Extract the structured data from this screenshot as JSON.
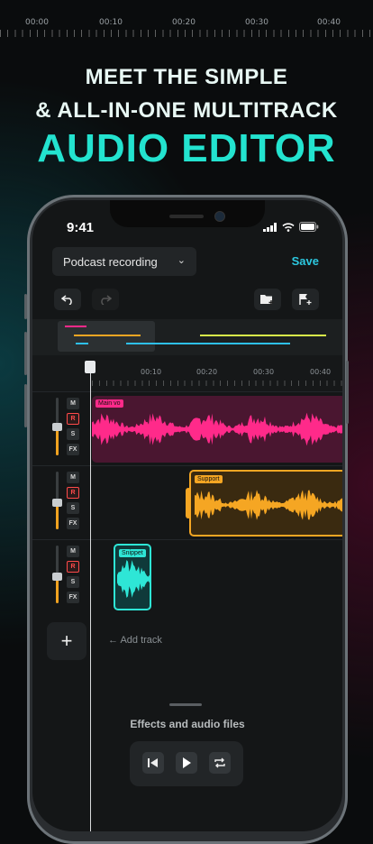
{
  "top_ruler": {
    "labels": [
      "00:00",
      "00:10",
      "00:20",
      "00:30",
      "00:40"
    ]
  },
  "headline": {
    "line1": "MEET THE SIMPLE",
    "line2": "& ALL-IN-ONE MULTITRACK",
    "line3": "AUDIO EDITOR"
  },
  "status_bar": {
    "time": "9:41"
  },
  "editor": {
    "project_name": "Podcast recording",
    "save_label": "Save",
    "timeline_labels": [
      "00:10",
      "00:20",
      "00:30",
      "00:40"
    ],
    "tracks": [
      {
        "controls": [
          "M",
          "R",
          "S",
          "FX"
        ],
        "volume": 0.45,
        "clip_label": "Main vo",
        "clip_color": "#ff2a8a"
      },
      {
        "controls": [
          "M",
          "R",
          "S",
          "FX"
        ],
        "volume": 0.5,
        "clip_label": "Support",
        "clip_color": "#f5a623"
      },
      {
        "controls": [
          "M",
          "R",
          "S",
          "FX"
        ],
        "volume": 0.5,
        "clip_label": "Snippet",
        "clip_color": "#2ee6d6"
      }
    ],
    "add_track_label": "← Add track",
    "bottom_sheet_title": "Effects and audio files"
  },
  "colors": {
    "accent_cyan": "#23e3cf",
    "save_blue": "#2cc8e0",
    "pink": "#ff2a8a",
    "orange": "#f5a623"
  }
}
